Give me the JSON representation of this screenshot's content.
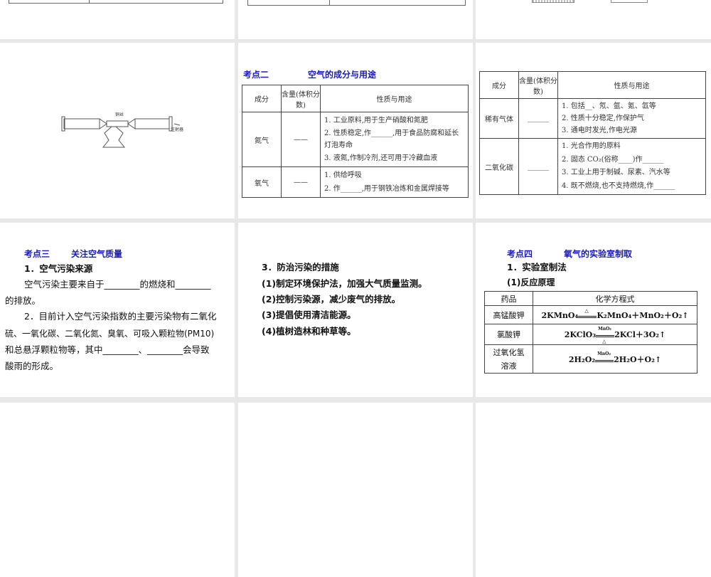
{
  "slide_r2c2": {
    "heading_num": "考点二",
    "heading_title": "空气的成分与用途",
    "headers": [
      "成分",
      "含量(体积分数)",
      "性质与用途"
    ],
    "rows": [
      {
        "name": "氮气",
        "content": "——",
        "uses": [
          "1. 工业原料,用于生产硝酸和氮肥",
          "2. 性质稳定,作______,用于食品防腐和延长灯泡寿命",
          "3. 液氮,作制冷剂,还可用于冷藏血液"
        ]
      },
      {
        "name": "氧气",
        "content": "——",
        "uses": [
          "1. 供给呼吸",
          "2. 作______,用于钢铁冶炼和金属焊接等"
        ]
      }
    ]
  },
  "slide_r2c3": {
    "headers": [
      "成分",
      "含量(体积分数)",
      "性质与用途"
    ],
    "rows": [
      {
        "name": "稀有气体",
        "content": "______",
        "uses": [
          "1. 包括__、氖、氩、氪、氙等",
          "2. 性质十分稳定,作保护气",
          "3. 通电时发光,作电光源"
        ]
      },
      {
        "name": "二氧化碳",
        "content": "______",
        "uses": [
          "1. 光合作用的原料",
          "2. 固态 CO₂(俗称____)作______",
          "3. 工业上用于制碱、尿素、汽水等",
          "4. 既不燃烧,也不支持燃烧,作______"
        ]
      }
    ]
  },
  "slide_r2c1": {
    "label_copper": "铜丝",
    "label_syringe": "注射器"
  },
  "slide_r3c1": {
    "heading_num": "考点三",
    "heading_title": "关注空气质量",
    "lines": [
      "1．空气污染来源",
      "空气污染主要来自于________的燃烧和________",
      "的排放。",
      "2．目前计入空气污染指数的主要污染物有二氧化",
      "硫、一氧化碳、二氧化氮、臭氧、可吸入颗粒物(PM10)",
      "和总悬浮颗粒物等，其中________、________会导致",
      "酸雨的形成。"
    ]
  },
  "slide_r3c2": {
    "lines": [
      "3．防治污染的措施",
      "(1)制定环境保护法，加强大气质量监测。",
      "(2)控制污染源，减少废气的排放。",
      "(3)提倡使用清洁能源。",
      "(4)植树造林和种草等。"
    ]
  },
  "slide_r3c3": {
    "heading_num": "考点四",
    "heading_title": "氧气的实验室制取",
    "sub1": "1．实验室制法",
    "sub2": "(1)反应原理",
    "headers": [
      "药品",
      "化学方程式"
    ],
    "rows": [
      {
        "drug": "高锰酸钾",
        "eq_left": "2KMnO₄",
        "cond_top": "△",
        "cond_bottom": "",
        "eq_right": "K₂MnO₄＋MnO₂＋O₂↑"
      },
      {
        "drug": "氯酸钾",
        "eq_left": "2KClO₃",
        "cond_top": "MnO₂",
        "cond_bottom": "△",
        "eq_right": "2KCl＋3O₂↑"
      },
      {
        "drug": "过氧化氢溶液",
        "eq_left": "2H₂O₂",
        "cond_top": "MnO₂",
        "cond_bottom": "",
        "eq_right": "2H₂O＋O₂↑"
      }
    ]
  }
}
